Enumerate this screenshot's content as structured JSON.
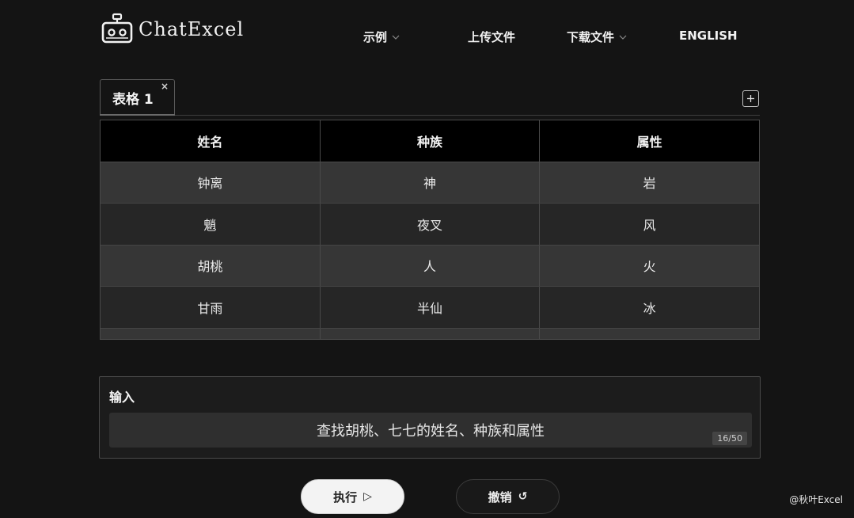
{
  "header": {
    "brand": "ChatExcel",
    "nav": [
      {
        "label": "示例",
        "has_dropdown": true
      },
      {
        "label": "上传文件",
        "has_dropdown": false
      },
      {
        "label": "下载文件",
        "has_dropdown": true
      },
      {
        "label": "ENGLISH",
        "has_dropdown": false
      }
    ]
  },
  "tabs": {
    "items": [
      {
        "label": "表格 1",
        "close": "×"
      }
    ],
    "add_label": "+"
  },
  "table": {
    "columns": [
      "姓名",
      "种族",
      "属性"
    ],
    "rows": [
      [
        "钟离",
        "神",
        "岩"
      ],
      [
        "魈",
        "夜叉",
        "风"
      ],
      [
        "胡桃",
        "人",
        "火"
      ],
      [
        "甘雨",
        "半仙",
        "冰"
      ]
    ]
  },
  "input": {
    "title": "输入",
    "value": "查找胡桃、七七的姓名、种族和属性",
    "counter": "16/50"
  },
  "actions": {
    "run_label": "执行",
    "run_icon": "▷",
    "undo_label": "撤销",
    "undo_icon": "↺"
  },
  "watermark": "@秋叶Excel",
  "colors": {
    "background": "#141414",
    "header_row": "#000000",
    "row_odd": "#363636",
    "row_even": "#262626"
  }
}
